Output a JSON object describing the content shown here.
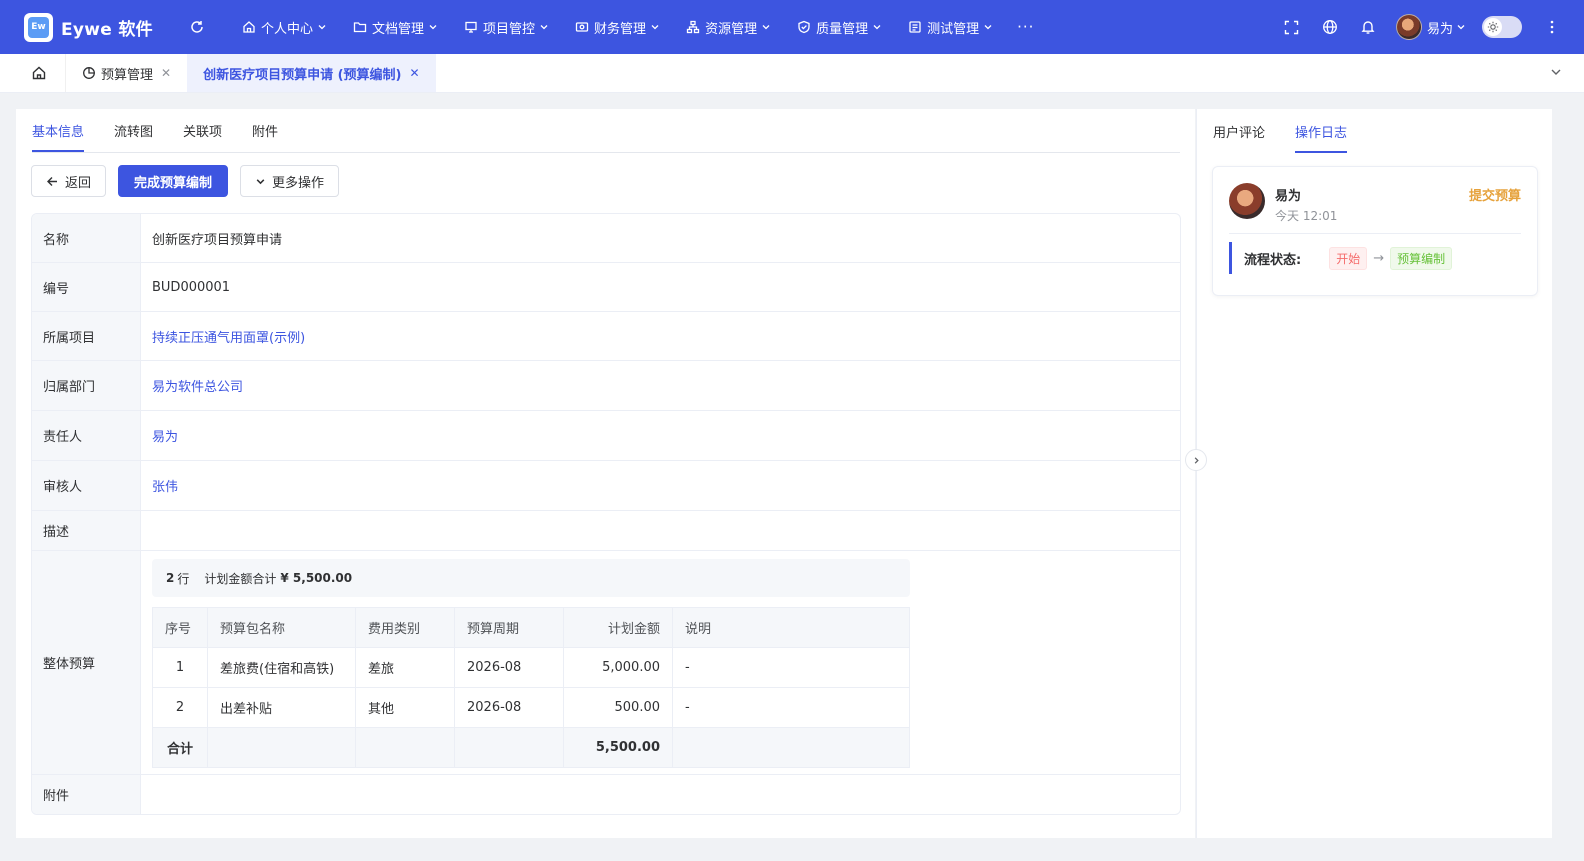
{
  "app": {
    "brand": "Eywe 软件",
    "logo_text": "Ew"
  },
  "nav": {
    "items": [
      {
        "label": "个人中心",
        "icon": "home-icon"
      },
      {
        "label": "文档管理",
        "icon": "folder-icon"
      },
      {
        "label": "项目管控",
        "icon": "project-icon"
      },
      {
        "label": "财务管理",
        "icon": "finance-icon"
      },
      {
        "label": "资源管理",
        "icon": "resource-icon"
      },
      {
        "label": "质量管理",
        "icon": "shield-icon"
      },
      {
        "label": "测试管理",
        "icon": "test-icon"
      }
    ],
    "more": "···"
  },
  "header_user": {
    "name": "易为"
  },
  "tabs": {
    "items": [
      {
        "label": "预算管理",
        "icon": "pie-chart-icon"
      },
      {
        "label": "创新医疗项目预算申请 (预算编制)"
      }
    ]
  },
  "main": {
    "subtabs": [
      "基本信息",
      "流转图",
      "关联项",
      "附件"
    ],
    "actions": {
      "back": "返回",
      "complete": "完成预算编制",
      "more": "更多操作"
    },
    "fields": {
      "name": {
        "label": "名称",
        "value": "创新医疗项目预算申请"
      },
      "code": {
        "label": "编号",
        "value": "BUD000001"
      },
      "project": {
        "label": "所属项目",
        "value": "持续正压通气用面罩(示例)"
      },
      "dept": {
        "label": "归属部门",
        "value": "易为软件总公司"
      },
      "owner": {
        "label": "责任人",
        "value": "易为"
      },
      "reviewer": {
        "label": "审核人",
        "value": "张伟"
      },
      "desc": {
        "label": "描述",
        "value": ""
      },
      "budget": {
        "label": "整体预算"
      },
      "attachment": {
        "label": "附件",
        "value": ""
      }
    },
    "budget": {
      "row_count": "2",
      "row_unit": "行",
      "amount_label": "计划金额合计",
      "amount_value": "¥ 5,500.00",
      "columns": [
        "序号",
        "预算包名称",
        "费用类别",
        "预算周期",
        "计划金额",
        "说明"
      ],
      "rows": [
        [
          "1",
          "差旅费(住宿和高铁)",
          "差旅",
          "2026-08",
          "5,000.00",
          "-"
        ],
        [
          "2",
          "出差补贴",
          "其他",
          "2026-08",
          "500.00",
          "-"
        ]
      ],
      "total_label": "合计",
      "total_value": "5,500.00"
    }
  },
  "side": {
    "tabs": [
      "用户评论",
      "操作日志"
    ],
    "log": {
      "user": "易为",
      "time": "今天 12:01",
      "action": "提交预算",
      "flow_label": "流程状态:",
      "from": "开始",
      "to": "预算编制"
    }
  },
  "colors": {
    "primary": "#3d55e0",
    "warning": "#e6a23c",
    "danger": "#f56c6c",
    "success": "#67c23a"
  }
}
